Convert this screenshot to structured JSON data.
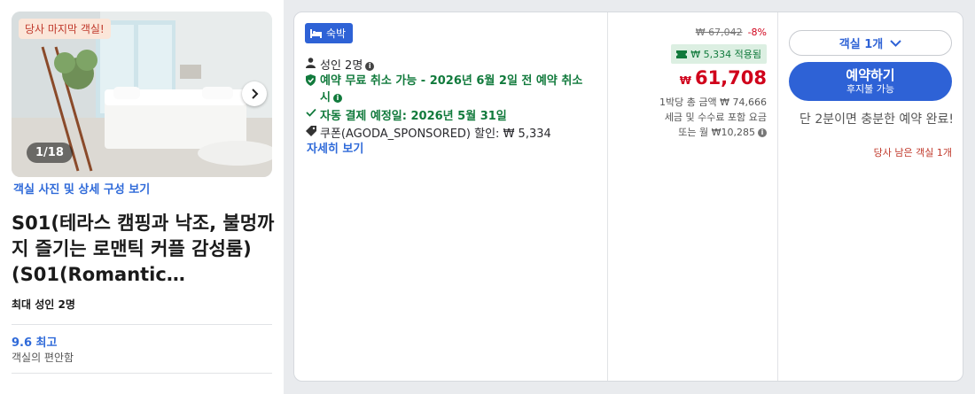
{
  "photo": {
    "badge": "당사 마지막 객실!",
    "counter": "1/18",
    "link": "객실 사진 및 상세 구성 보기"
  },
  "room": {
    "title": "S01(테라스 캠핑과 낙조, 불멍까지 즐기는 로맨틱 커플 감성룸) (S01(Romantic…",
    "max_guests": "최대 성인 2명",
    "rating": "9.6 최고",
    "rating_sub": "객실의 편안함"
  },
  "offer": {
    "stay_badge": "숙박",
    "adults": "성인 2명",
    "free_cancel": "예약 무료 취소 가능 - 2026년 6월 2일 전 예약 취소 시",
    "autopay": "자동 결제 예정일: 2026년 5월 31일",
    "coupon": "쿠폰(AGODA_SPONSORED) 할인: ₩ 5,334",
    "details_link": "자세히 보기"
  },
  "pricing": {
    "original_price": "₩ 67,042",
    "discount_pct": "-8%",
    "applied": "₩ 5,334 적용됨",
    "currency": "₩",
    "price": "61,708",
    "per_night_total": "1박당 총 금액 ₩ 74,666",
    "tax_note": "세금 및 수수료 포함 요금",
    "monthly": "또는 월 ₩10,285"
  },
  "booking": {
    "room_select": "객실 1개",
    "book_label": "예약하기",
    "book_sub": "후지불 가능",
    "quick_note": "단 2분이면 충분한 예약 완료!",
    "rooms_left": "당사 남은 객실 1개"
  },
  "colors": {
    "accent": "#2e62d6",
    "price": "#d0021b",
    "green": "#117a3c"
  }
}
